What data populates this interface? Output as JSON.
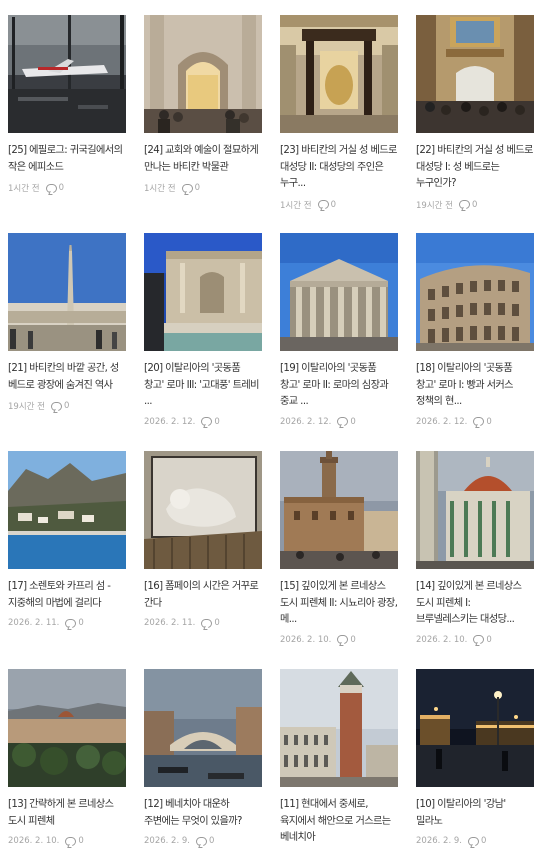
{
  "posts": [
    {
      "title": "[25] 에필로그: 귀국길에서의 작은 에피소드",
      "time": "1시간 전",
      "comments": "0",
      "thumb": "airport"
    },
    {
      "title": "[24] 교회와 예술이 절묘하게 만나는 바티칸 박물관",
      "time": "1시간 전",
      "comments": "0",
      "thumb": "museum-arch"
    },
    {
      "title": "[23] 바티칸의 거실 성 베드로 대성당 II: 대성당의 주인은 누구...",
      "time": "1시간 전",
      "comments": "0",
      "thumb": "baldachin"
    },
    {
      "title": "[22] 바티칸의 거실 성 베드로 대성당 I: 성 베드로는 누구인가?",
      "time": "19시간 전",
      "comments": "0",
      "thumb": "basilica-door"
    },
    {
      "title": "[21] 바티칸의 바깥 공간, 성 베드로 광장에 숨겨진 역사",
      "time": "19시간 전",
      "comments": "0",
      "thumb": "square-obelisk"
    },
    {
      "title": "[20] 이탈리아의 '곳동품 창고' 로마 III: '고대풍' 트레비 ...",
      "time": "2026. 2. 12.",
      "comments": "0",
      "thumb": "trevi"
    },
    {
      "title": "[19] 이탈리아의 '곳동품 창고' 로마 II: 로마의 심장과 중교 ...",
      "time": "2026. 2. 12.",
      "comments": "0",
      "thumb": "pantheon"
    },
    {
      "title": "[18] 이탈리아의 '곳동품 창고' 로마 I: 빵과 서커스 정책의 현...",
      "time": "2026. 2. 12.",
      "comments": "0",
      "thumb": "colosseum"
    },
    {
      "title": "[17] 소렌토와 카프리 섬 - 지중해의 마법에 걸리다",
      "time": "2026. 2. 11.",
      "comments": "0",
      "thumb": "capri"
    },
    {
      "title": "[16] 폼페이의 시간은 거꾸로 간다",
      "time": "2026. 2. 11.",
      "comments": "0",
      "thumb": "pompeii"
    },
    {
      "title": "[15] 깊이있게 본 르네상스 도시 피렌체 II: 시뇨리아 광장, 메...",
      "time": "2026. 2. 10.",
      "comments": "0",
      "thumb": "signoria"
    },
    {
      "title": "[14] 깊이있게 본 르네상스 도시 피렌체 I: 브루넬레스키는 대성당...",
      "time": "2026. 2. 10.",
      "comments": "0",
      "thumb": "duomo"
    },
    {
      "title": "[13] 간략하게 본 르네상스 도시 피렌체",
      "time": "2026. 2. 10.",
      "comments": "0",
      "thumb": "florence-view"
    },
    {
      "title": "[12] 베네치아 대운하 주변에는 무엇이 있을까?",
      "time": "2026. 2. 9.",
      "comments": "0",
      "thumb": "rialto"
    },
    {
      "title": "[11] 현대에서 중세로, 육지에서 해안으로 거스르는 베네치아",
      "time": "",
      "comments": "",
      "thumb": "campanile"
    },
    {
      "title": "[10] 이탈리아의 '강남' 밀라노",
      "time": "2026. 2. 9.",
      "comments": "0",
      "thumb": "milan-night"
    }
  ]
}
